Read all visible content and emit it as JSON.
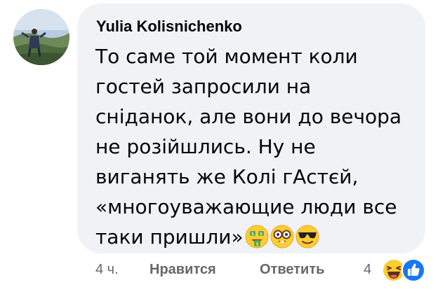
{
  "comment": {
    "author": "Yulia Kolisnichenko",
    "lines": [
      "То саме той момент коли",
      "гостей запросили на",
      "сніданок, але вони до вечора",
      "не розійшлись. Ну не",
      "виганять же Колі гАстєй,",
      "«многоуважающие люди все",
      "таки пришли»"
    ],
    "inline_emojis": [
      "money-mouth-face",
      "nerd-face",
      "smiling-face-with-sunglasses"
    ],
    "avatar": "profile-photo"
  },
  "actions": {
    "time": "4 ч.",
    "like_label": "Нравится",
    "reply_label": "Ответить"
  },
  "reactions": {
    "count": "4",
    "icons": [
      "haha-reaction",
      "like-reaction"
    ]
  },
  "colors": {
    "bubble": "#f0f2f5",
    "text": "#050505",
    "meta": "#65676b",
    "like_blue": "#1877f2",
    "emoji_yellow": "#ffcc33"
  }
}
